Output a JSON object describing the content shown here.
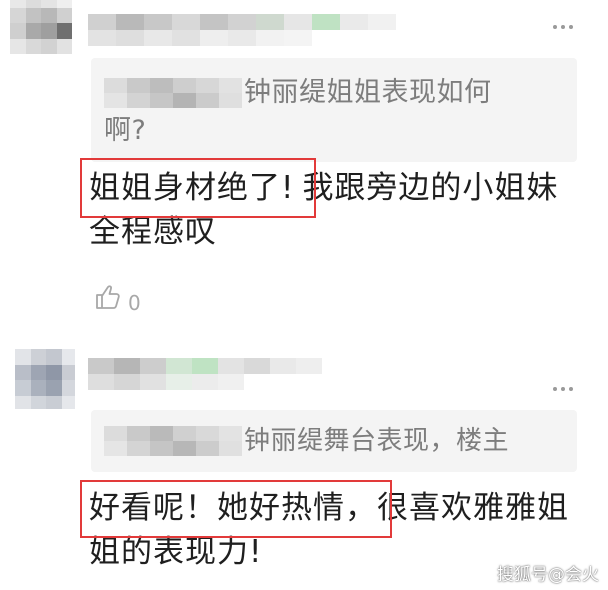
{
  "comment1": {
    "quote": "钟丽缇姐姐表现如何啊?",
    "reply_highlight": "姐姐身材绝了!",
    "reply_rest": "我跟旁边的小姐妹全程感叹",
    "like_icon": "thumbs-up-icon",
    "like_count": "0"
  },
  "comment2": {
    "quote": "钟丽缇舞台表现，楼主",
    "reply_highlight": "好看呢！她好热情，",
    "reply_rest": "很喜欢雅雅姐姐的表现力!"
  },
  "watermark": "搜狐号@会火",
  "colors": {
    "highlight_border": "#e23a3a",
    "quote_background": "#f4f4f4",
    "quote_text": "#7d7d7d",
    "reply_text": "#1f1f1f"
  }
}
